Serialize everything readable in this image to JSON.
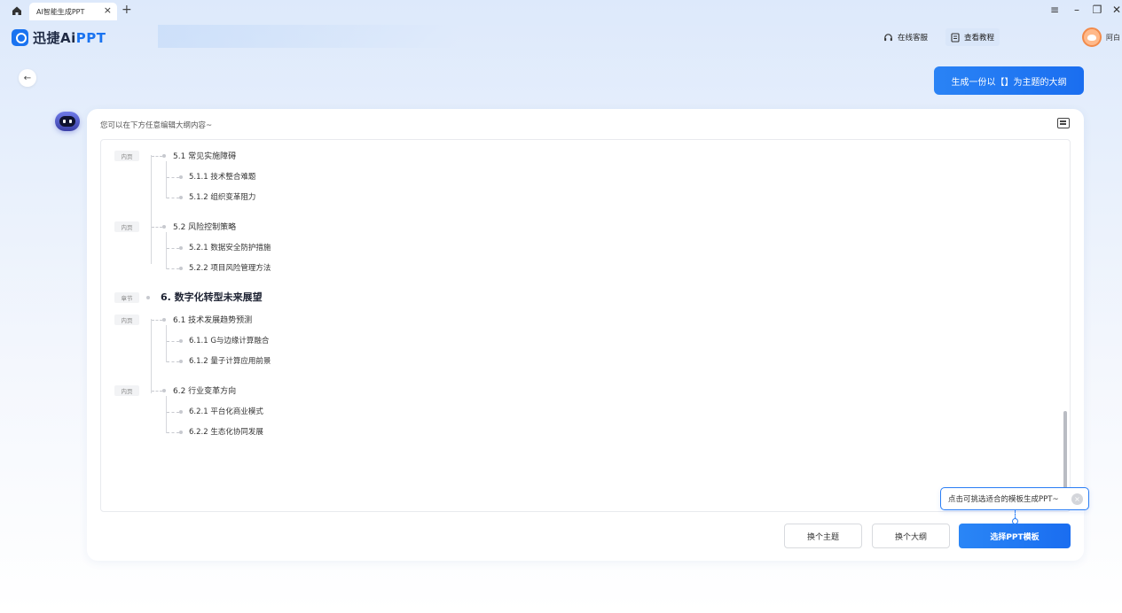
{
  "window": {
    "tab_title": "AI智能生成PPT",
    "tab_close": "×",
    "tab_add": "+",
    "controls": {
      "menu": "≡",
      "minimize": "–",
      "restore": "❐",
      "close": "✕"
    }
  },
  "header": {
    "logo_main": "迅捷Ai",
    "logo_ppt": "PPT",
    "service": {
      "icon": "headset-icon",
      "label": "在线客服"
    },
    "tutorial": {
      "icon": "document-icon",
      "label": "查看教程"
    },
    "user_name": "阿白"
  },
  "prompt": {
    "text": "生成一份以【】为主题的大纲"
  },
  "card": {
    "hint": "您可以在下方任意编辑大纲内容~",
    "outline": {
      "badge_page": "内页",
      "badge_chapter": "章节",
      "items": [
        {
          "level": 2,
          "badge": "内页",
          "text": "5.1 常见实施障碍"
        },
        {
          "level": 3,
          "text": "5.1.1 技术整合难题"
        },
        {
          "level": 3,
          "text": "5.1.2 组织变革阻力"
        },
        {
          "level": 2,
          "badge": "内页",
          "text": "5.2 风险控制策略"
        },
        {
          "level": 3,
          "text": "5.2.1 数据安全防护措施"
        },
        {
          "level": 3,
          "text": "5.2.2 项目风险管理方法"
        },
        {
          "level": 1,
          "badge": "章节",
          "text": "6. 数字化转型未来展望"
        },
        {
          "level": 2,
          "badge": "内页",
          "text": "6.1 技术发展趋势预测"
        },
        {
          "level": 3,
          "text": "6.1.1 G与边缘计算融合"
        },
        {
          "level": 3,
          "text": "6.1.2 量子计算应用前景"
        },
        {
          "level": 2,
          "badge": "内页",
          "text": "6.2 行业变革方向"
        },
        {
          "level": 3,
          "text": "6.2.1 平台化商业模式"
        },
        {
          "level": 3,
          "text": "6.2.2 生态化协同发展"
        }
      ]
    },
    "tooltip": {
      "text": "点击可挑选适合的模板生成PPT~",
      "close": "×"
    },
    "buttons": {
      "change_topic": "换个主题",
      "change_outline": "换个大纲",
      "choose_template": "选择PPT模板"
    }
  },
  "colors": {
    "accent": "#1a73f0",
    "accent_light": "#2a86f6",
    "page_bg": "#e8f0fc"
  }
}
